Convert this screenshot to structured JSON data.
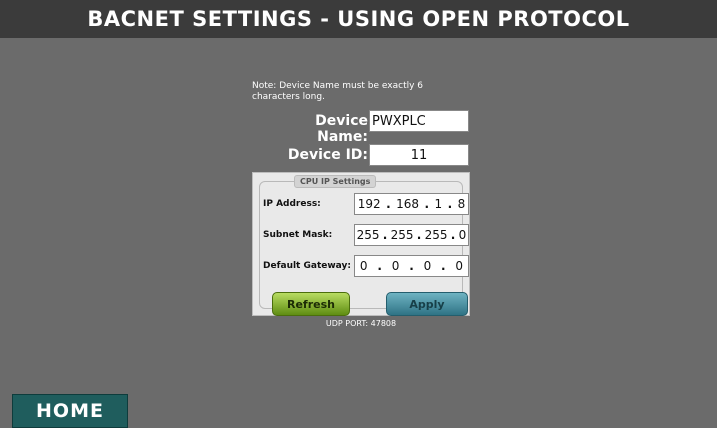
{
  "title": "BACNET SETTINGS - USING OPEN PROTOCOL",
  "note": "Note: Device Name must be exactly 6 characters long.",
  "device_name": {
    "label": "Device Name:",
    "value": "PWXPLC"
  },
  "device_id": {
    "label": "Device ID:",
    "value": "11"
  },
  "cpu_ip_settings": {
    "title": "CPU IP Settings",
    "ip_address": {
      "label": "IP Address:",
      "octets": [
        "192",
        "168",
        "1",
        "8"
      ]
    },
    "subnet_mask": {
      "label": "Subnet Mask:",
      "octets": [
        "255",
        "255",
        "255",
        "0"
      ]
    },
    "default_gateway": {
      "label": "Default Gateway:",
      "octets": [
        "0",
        "0",
        "0",
        "0"
      ]
    },
    "separator": ".",
    "refresh_label": "Refresh",
    "apply_label": "Apply"
  },
  "udp_port": "UDP PORT: 47808",
  "home_label": "HOME",
  "colors": {
    "background": "#6b6b6b",
    "title_bar": "#3b3b3b",
    "refresh": "#8bbd2c",
    "apply": "#3f8b9c",
    "home": "#1f5d5d"
  }
}
